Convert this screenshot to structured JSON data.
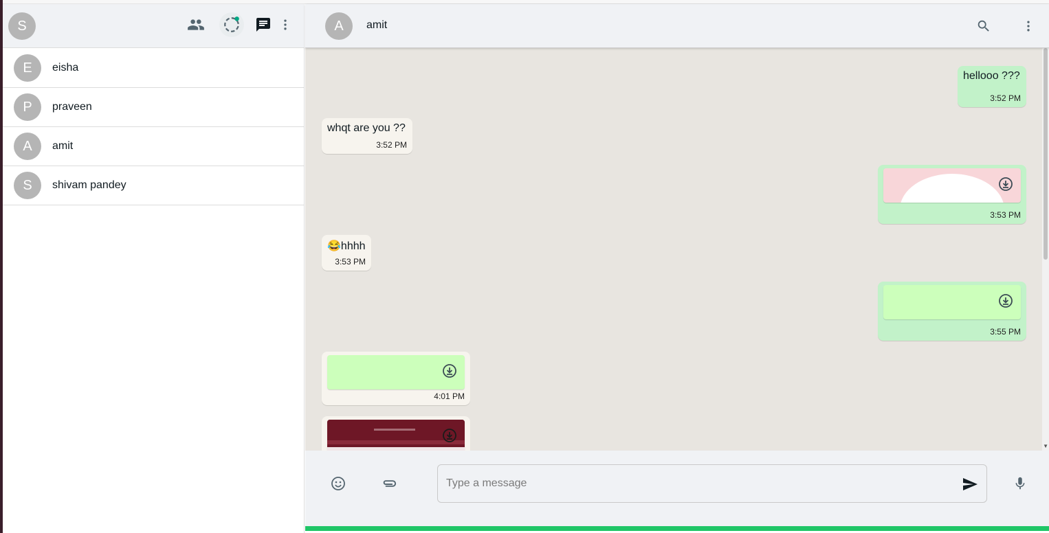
{
  "user": {
    "avatar_letter": "S"
  },
  "sidebar": {
    "icons": [
      "community-icon",
      "status-icon",
      "new-chat-icon",
      "menu-dots-icon"
    ],
    "chats": [
      {
        "letter": "E",
        "name": "eisha"
      },
      {
        "letter": "P",
        "name": "praveen"
      },
      {
        "letter": "A",
        "name": "amit"
      },
      {
        "letter": "S",
        "name": "shivam pandey"
      }
    ]
  },
  "conversation": {
    "contact_letter": "A",
    "contact_name": "amit",
    "icons": [
      "search-icon",
      "menu-dots-icon"
    ]
  },
  "messages": [
    {
      "direction": "out",
      "type": "text",
      "text": "hellooo ???",
      "time": "3:52 PM"
    },
    {
      "direction": "in",
      "type": "text",
      "text": "whqt are you ??",
      "time": "3:52 PM"
    },
    {
      "direction": "out",
      "type": "image",
      "time": "3:53 PM"
    },
    {
      "direction": "in",
      "type": "text",
      "text": "😂hhhh",
      "time": "3:53 PM"
    },
    {
      "direction": "out",
      "type": "image",
      "time": "3:55 PM"
    },
    {
      "direction": "in",
      "type": "image",
      "time": "4:01 PM"
    },
    {
      "direction": "in",
      "type": "image",
      "time": ""
    }
  ],
  "composer": {
    "placeholder": "Type a message",
    "icons": [
      "emoji-icon",
      "attach-icon",
      "send-icon",
      "mic-icon"
    ]
  },
  "colors": {
    "outgoing_bubble": "#c2f2c9",
    "incoming_bubble": "#f7f4ee",
    "accent": "#1fc667",
    "status_dot": "#00a884"
  }
}
